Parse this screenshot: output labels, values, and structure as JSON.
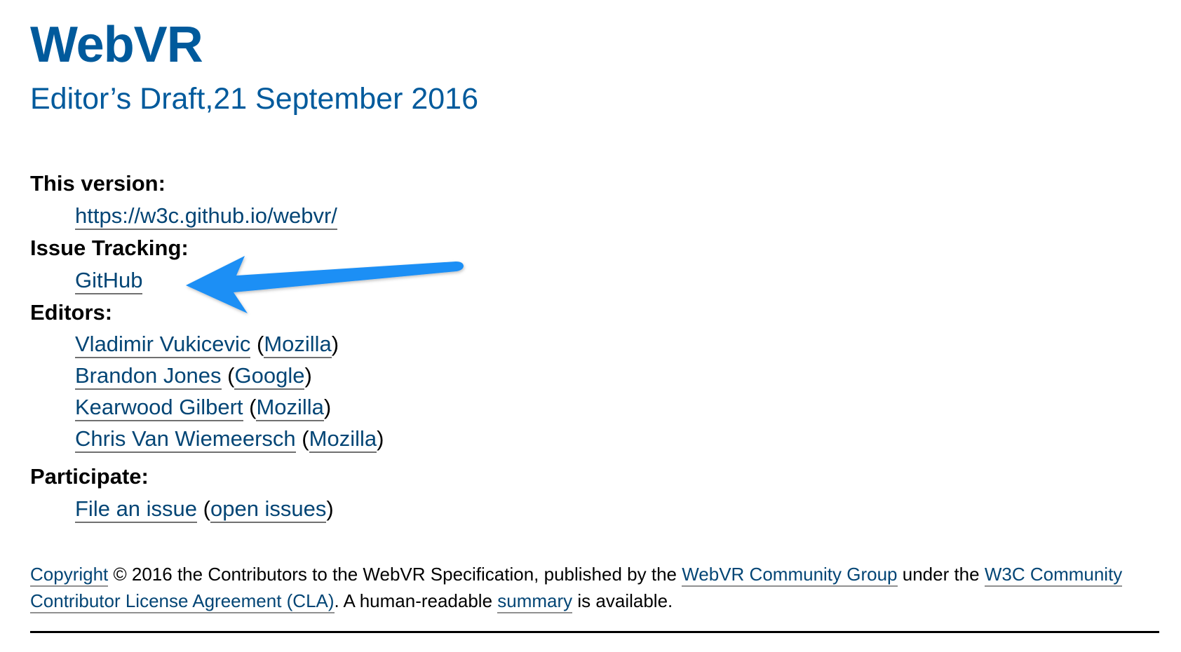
{
  "header": {
    "title": "WebVR",
    "subtitle": "Editor’s Draft,21 September 2016"
  },
  "metadata": {
    "this_version": {
      "label": "This version:",
      "url": "https://w3c.github.io/webvr/"
    },
    "issue_tracking": {
      "label": "Issue Tracking:",
      "link": "GitHub"
    },
    "editors": {
      "label": "Editors:",
      "items": [
        {
          "name": "Vladimir Vukicevic",
          "org": "Mozilla"
        },
        {
          "name": "Brandon Jones",
          "org": "Google"
        },
        {
          "name": "Kearwood Gilbert",
          "org": "Mozilla"
        },
        {
          "name": "Chris Van Wiemeersch",
          "org": "Mozilla"
        }
      ]
    },
    "participate": {
      "label": "Participate:",
      "file_issue": "File an issue",
      "open_issues": "open issues"
    }
  },
  "copyright": {
    "copyright_link": "Copyright",
    "text1": " © 2016 the Contributors to the WebVR Specification, published by the ",
    "group_link": "WebVR Community Group",
    "text2": " under the ",
    "cla_link": "W3C Community Contributor License Agreement (CLA)",
    "text3": ". A human-readable ",
    "summary_link": "summary",
    "text4": " is available."
  },
  "annotation": {
    "arrow_color": "#1e8ff5",
    "target": "GitHub"
  },
  "colors": {
    "heading": "#005a9c",
    "link": "#034575"
  }
}
